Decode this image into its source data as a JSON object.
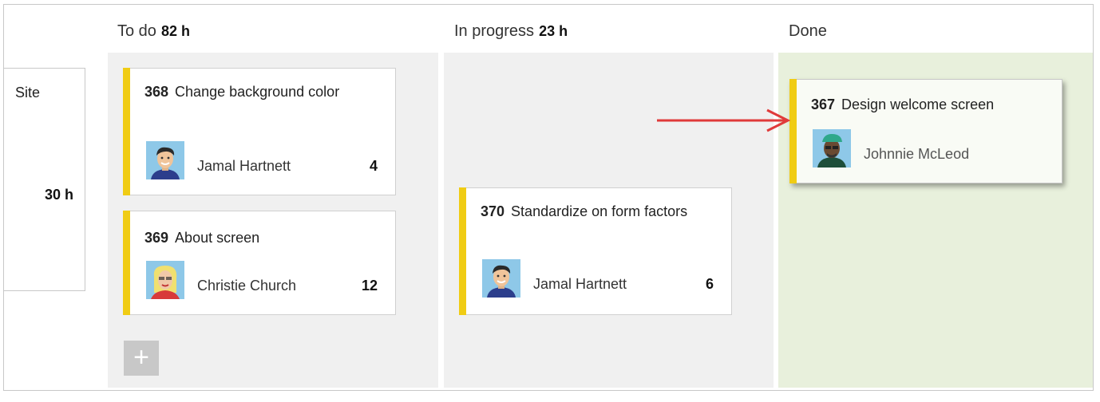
{
  "columns": {
    "todo": {
      "name": "To do",
      "hours": "82 h"
    },
    "progress": {
      "name": "In progress",
      "hours": "23 h"
    },
    "done": {
      "name": "Done"
    }
  },
  "story": {
    "title": "Site",
    "hours": "30 h"
  },
  "cards": {
    "c368": {
      "id": "368",
      "title": "Change background color",
      "assignee": "Jamal Hartnett",
      "remaining": "4"
    },
    "c369": {
      "id": "369",
      "title": "About screen",
      "assignee": "Christie Church",
      "remaining": "12"
    },
    "c370": {
      "id": "370",
      "title": "Standardize on form factors",
      "assignee": "Jamal Hartnett",
      "remaining": "6"
    },
    "c367": {
      "id": "367",
      "title": "Design welcome screen",
      "assignee": "Johnnie McLeod"
    }
  },
  "add_button_label": "+",
  "colors": {
    "card_bar": "#f0cc14",
    "lane": "#f0f0f0",
    "done_lane": "#e8f0dc",
    "arrow": "#e03a3a"
  },
  "icons": [
    "add-icon",
    "drag-arrow-icon",
    "avatar-jamal",
    "avatar-christie",
    "avatar-johnnie"
  ]
}
